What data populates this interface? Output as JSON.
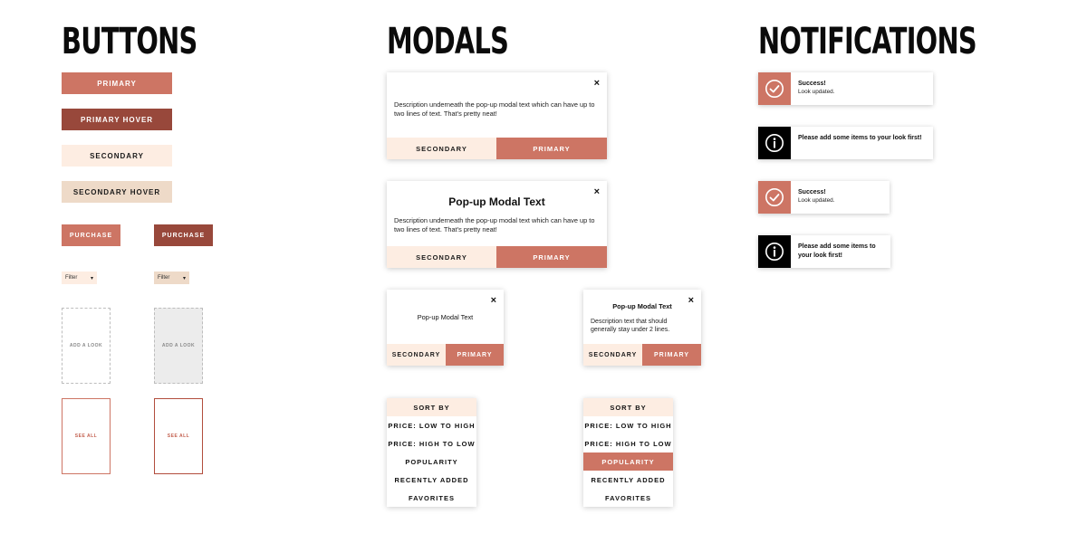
{
  "headings": {
    "buttons": "BUTTONS",
    "modals": "MODALS",
    "notifications": "NOTIFICATIONS"
  },
  "colors": {
    "primary": "#cd7564",
    "primary_hover": "#98483b",
    "secondary": "#fdede2",
    "secondary_hover": "#eedac8",
    "notification_info": "#000000"
  },
  "buttons": {
    "primary": "PRIMARY",
    "primary_hover": "PRIMARY HOVER",
    "secondary": "SECONDARY",
    "secondary_hover": "SECONDARY HOVER",
    "purchase": "PURCHASE",
    "purchase_hover": "PURCHASE",
    "filter": "Filter",
    "filter_hover": "Filter",
    "add_look": "ADD A LOOK",
    "add_look_hover": "ADD A LOOK",
    "see_all": "SEE ALL",
    "see_all_hover": "SEE ALL"
  },
  "modals": {
    "m1": {
      "close": "×",
      "description": "Description underneath the pop-up modal text which can have up to two lines of text. That's pretty neat!",
      "secondary": "SECONDARY",
      "primary": "PRIMARY"
    },
    "m2": {
      "close": "×",
      "title": "Pop-up Modal Text",
      "description": "Description underneath the pop-up modal text which can have up to two lines of text. That's pretty neat!",
      "secondary": "SECONDARY",
      "primary": "PRIMARY"
    },
    "m3": {
      "close": "×",
      "title": "Pop-up Modal Text",
      "secondary": "SECONDARY",
      "primary": "PRIMARY"
    },
    "m4": {
      "close": "×",
      "title": "Pop-up Modal Text",
      "description": "Description text that should generally stay under 2 lines.",
      "secondary": "SECONDARY",
      "primary": "PRIMARY"
    }
  },
  "sort_menus": [
    {
      "header": "SORT BY",
      "items": [
        "PRICE: LOW TO HIGH",
        "PRICE: HIGH TO LOW",
        "POPULARITY",
        "RECENTLY ADDED",
        "FAVORITES"
      ]
    },
    {
      "header": "SORT BY",
      "items": [
        "PRICE: LOW TO HIGH",
        "PRICE: HIGH TO LOW",
        "POPULARITY",
        "RECENTLY ADDED",
        "FAVORITES"
      ],
      "active": "POPULARITY"
    }
  ],
  "notifications": [
    {
      "type": "success",
      "icon": "check-circle-icon",
      "title": "Success!",
      "subtitle": "Look updated."
    },
    {
      "type": "info",
      "icon": "info-circle-icon",
      "title": "Please add some items to your look first!"
    },
    {
      "type": "success",
      "icon": "check-circle-icon",
      "title": "Success!",
      "subtitle": "Look updated."
    },
    {
      "type": "info",
      "icon": "info-circle-icon",
      "title": "Please add some items to your look first!"
    }
  ]
}
